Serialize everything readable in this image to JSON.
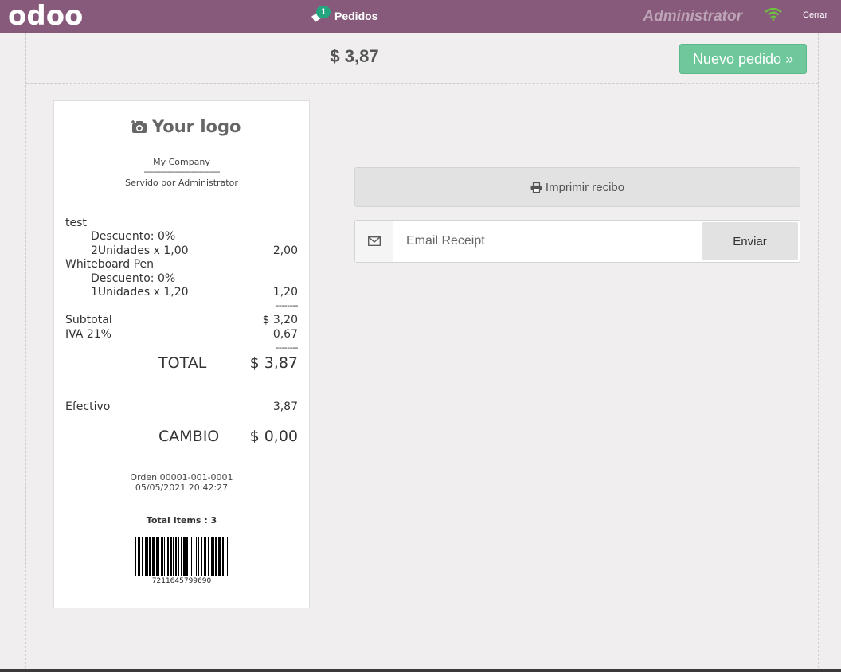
{
  "topbar": {
    "brand": "odoo",
    "orders_tab": {
      "count": "1",
      "label": "Pedidos"
    },
    "user": "Administrator",
    "close_label": "Cerrar"
  },
  "screen": {
    "amount_due": "$ 3,87",
    "new_order_label": "Nuevo pedido »"
  },
  "receipt": {
    "logo_text": "Your logo",
    "company": "My Company",
    "separator": "--------------------------------",
    "served_by": "Servido por Administrator",
    "lines": [
      {
        "name": "test",
        "discount": "Descuento: 0%",
        "qty": "2Unidades x 1,00",
        "amount": "2,00"
      },
      {
        "name": "Whiteboard Pen",
        "discount": "Descuento: 0%",
        "qty": "1Unidades x 1,20",
        "amount": "1,20"
      }
    ],
    "dashes": "--------",
    "subtotal_label": "Subtotal",
    "subtotal_value": "$ 3,20",
    "tax_label": "IVA 21%",
    "tax_value": "0,67",
    "total_label": "TOTAL",
    "total_value": "$ 3,87",
    "payment_label": "Efectivo",
    "payment_value": "3,87",
    "change_label": "CAMBIO",
    "change_value": "$ 0,00",
    "order_ref": "Orden 00001-001-0001",
    "order_date": "05/05/2021 20:42:27",
    "total_items": "Total Items : 3",
    "barcode_number": "7211645799690"
  },
  "actions": {
    "print_label": "Imprimir recibo",
    "email_placeholder": "Email Receipt",
    "send_label": "Enviar"
  },
  "colors": {
    "topbar": "#875a7b",
    "new_order": "#6ec89b",
    "badge": "#25a57f",
    "wifi": "#6ec040"
  }
}
